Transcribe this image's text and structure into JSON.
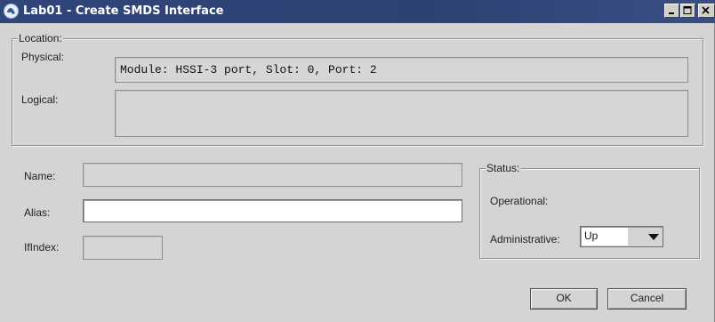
{
  "window": {
    "title": "Lab01 - Create SMDS Interface"
  },
  "location": {
    "legend": "Location:",
    "physical_label": "Physical:",
    "physical_value": "Module: HSSI-3 port, Slot: 0, Port: 2",
    "logical_label": "Logical:",
    "logical_value": ""
  },
  "form": {
    "name_label": "Name:",
    "name_value": "",
    "alias_label": "Alias:",
    "alias_value": "",
    "ifindex_label": "IfIndex:",
    "ifindex_value": ""
  },
  "status": {
    "legend": "Status:",
    "operational_label": "Operational:",
    "operational_value": "",
    "administrative_label": "Administrative:",
    "administrative_value": "Up"
  },
  "buttons": {
    "ok_label": "OK",
    "cancel_label": "Cancel"
  },
  "icons": {
    "app": "app-globe-icon",
    "minimize": "minimize-icon",
    "maximize": "maximize-icon",
    "close": "close-icon",
    "dropdown": "chevron-down-icon"
  }
}
